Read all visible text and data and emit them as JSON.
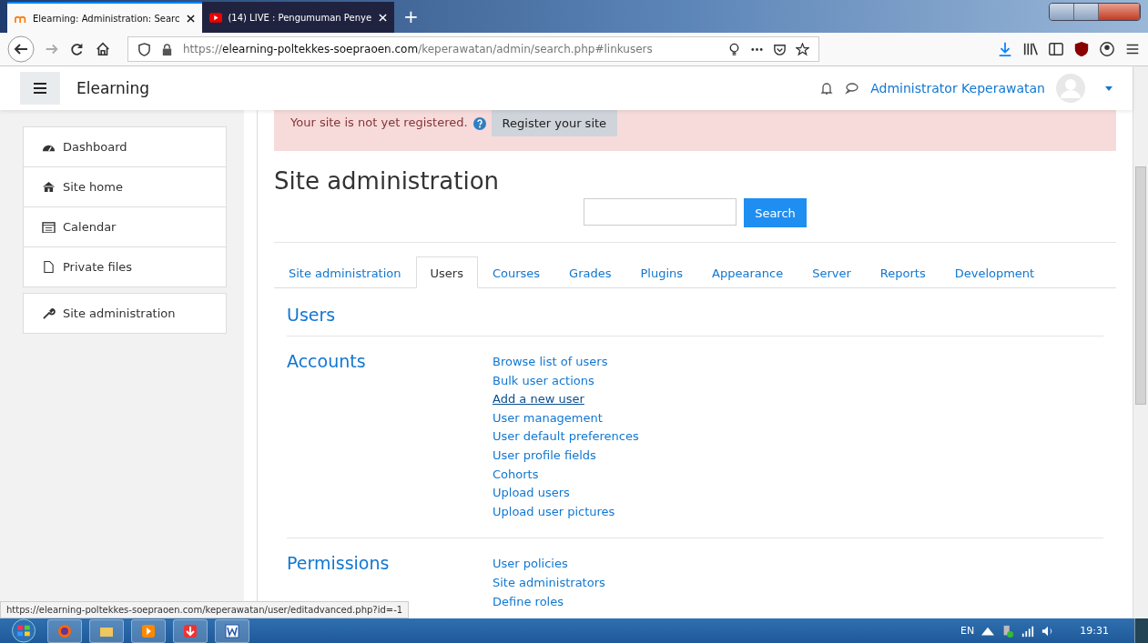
{
  "browser": {
    "tabs": [
      {
        "title": "Elearning: Administration: Searc",
        "selected": true
      },
      {
        "title": "(14) LIVE : Pengumuman Penye",
        "selected": false
      }
    ],
    "new_tab": "+",
    "url": {
      "scheme": "https://",
      "host": "elearning-poltekkes-soepraoen.com",
      "path": "/keperawatan/admin/search.php#linkusers"
    }
  },
  "header": {
    "site_name": "Elearning",
    "user_name": "Administrator Keperawatan"
  },
  "sidebar": {
    "items": [
      {
        "label": "Dashboard"
      },
      {
        "label": "Site home"
      },
      {
        "label": "Calendar"
      },
      {
        "label": "Private files"
      }
    ],
    "admin_item": {
      "label": "Site administration"
    }
  },
  "notice": {
    "text": "Your site is not yet registered.",
    "button": "Register your site"
  },
  "page_title": "Site administration",
  "search": {
    "button": "Search"
  },
  "tabs": [
    {
      "label": "Site administration",
      "selected": false
    },
    {
      "label": "Users",
      "selected": true
    },
    {
      "label": "Courses",
      "selected": false
    },
    {
      "label": "Grades",
      "selected": false
    },
    {
      "label": "Plugins",
      "selected": false
    },
    {
      "label": "Appearance",
      "selected": false
    },
    {
      "label": "Server",
      "selected": false
    },
    {
      "label": "Reports",
      "selected": false
    },
    {
      "label": "Development",
      "selected": false
    }
  ],
  "section_heading": "Users",
  "groups": [
    {
      "heading": "Accounts",
      "links": [
        {
          "label": "Browse list of users",
          "hovered": false
        },
        {
          "label": "Bulk user actions",
          "hovered": false
        },
        {
          "label": "Add a new user",
          "hovered": true
        },
        {
          "label": "User management",
          "hovered": false
        },
        {
          "label": "User default preferences",
          "hovered": false
        },
        {
          "label": "User profile fields",
          "hovered": false
        },
        {
          "label": "Cohorts",
          "hovered": false
        },
        {
          "label": "Upload users",
          "hovered": false
        },
        {
          "label": "Upload user pictures",
          "hovered": false
        }
      ]
    },
    {
      "heading": "Permissions",
      "links": [
        {
          "label": "User policies",
          "hovered": false
        },
        {
          "label": "Site administrators",
          "hovered": false
        },
        {
          "label": "Define roles",
          "hovered": false
        }
      ]
    }
  ],
  "status_url": "https://elearning-poltekkes-soepraoen.com/keperawatan/user/editadvanced.php?id=-1",
  "taskbar": {
    "language": "EN",
    "time": "19:31"
  }
}
